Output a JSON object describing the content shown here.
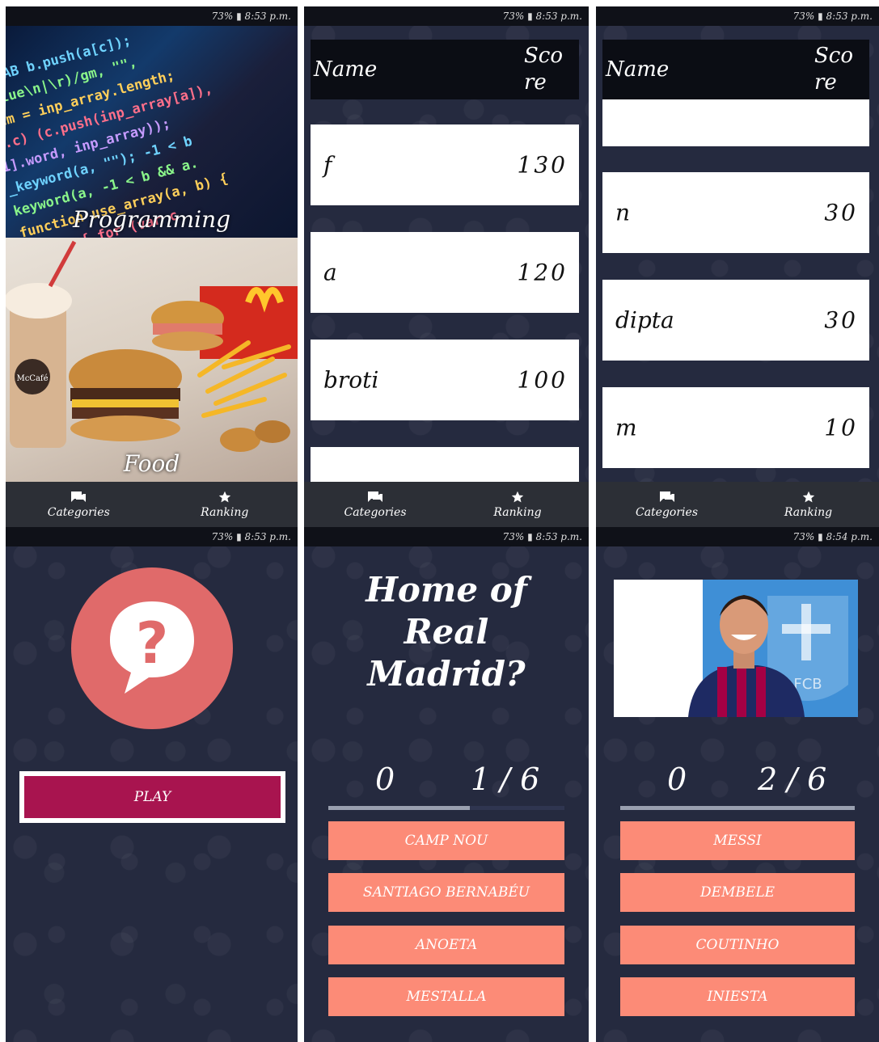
{
  "status": {
    "time_a": "73% ▮ 8:53 p.m.",
    "time_b": "73% ▮ 8:54 p.m."
  },
  "nav": {
    "categories": "Categories",
    "ranking": "Ranking"
  },
  "categories": {
    "tiles": [
      {
        "label": "Programming"
      },
      {
        "label": "Food"
      }
    ]
  },
  "ranking": {
    "header_name": "Name",
    "header_score": "Score",
    "list1": [
      {
        "name": "f",
        "score": "130"
      },
      {
        "name": "a",
        "score": "120"
      },
      {
        "name": "broti",
        "score": "100"
      }
    ],
    "list2": [
      {
        "name": "n",
        "score": "30"
      },
      {
        "name": "dipta",
        "score": "30"
      },
      {
        "name": "m",
        "score": "10"
      }
    ]
  },
  "home": {
    "play_label": "PLAY"
  },
  "quiz1": {
    "question": "Home of Real Madrid?",
    "score": "0",
    "progress_text": "1 / 6",
    "progress_fraction": 0.5,
    "answers": [
      "CAMP NOU",
      "SANTIAGO BERNABÉU",
      "ANOETA",
      "MESTALLA"
    ]
  },
  "quiz2": {
    "score": "0",
    "progress_text": "2 / 6",
    "progress_fraction": 1.0,
    "answers": [
      "MESSI",
      "DEMBELE",
      "COUTINHO",
      "INIESTA"
    ]
  },
  "colors": {
    "accent": "#fc8b77",
    "play": "#a8144f",
    "logo": "#e06a6a",
    "bg": "#252a3f"
  }
}
